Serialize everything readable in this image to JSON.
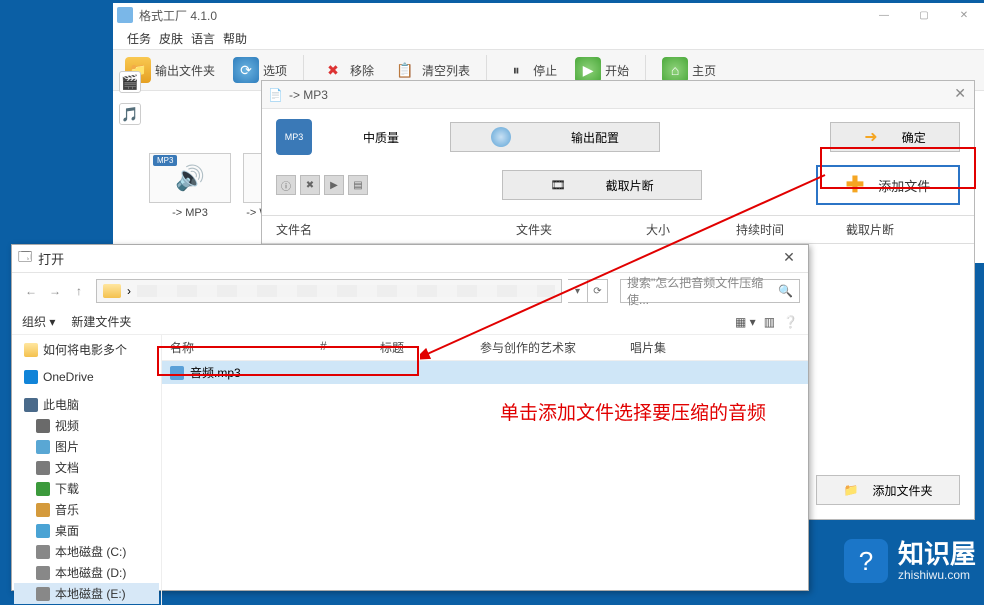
{
  "main": {
    "title": "格式工厂 4.1.0",
    "menu": [
      "任务",
      "皮肤",
      "语言",
      "帮助"
    ],
    "tools": {
      "outputFolder": "输出文件夹",
      "options": "选项",
      "remove": "移除",
      "clearList": "清空列表",
      "stop": "停止",
      "start": "开始",
      "home": "主页"
    },
    "thumb1": "-> MP3",
    "thumb1Badge": "MP3",
    "thumb2": "-> W"
  },
  "mp3win": {
    "title": "-> MP3",
    "iconLabel": "MP3",
    "quality": "中质量",
    "outputConfig": "输出配置",
    "ok": "确定",
    "clip": "截取片断",
    "addFile": "添加文件",
    "addFolder": "添加文件夹",
    "cols": [
      "文件名",
      "文件夹",
      "大小",
      "持续时间",
      "截取片断"
    ]
  },
  "open": {
    "title": "打开",
    "searchPlaceholder": "搜索\"怎么把音频文件压缩使...",
    "orgLabel": "组织",
    "newFolder": "新建文件夹",
    "tree": {
      "folder1": "如何将电影多个",
      "onedrive": "OneDrive",
      "pc": "此电脑",
      "video": "视频",
      "images": "图片",
      "docs": "文档",
      "downloads": "下载",
      "music": "音乐",
      "desktop": "桌面",
      "diskC": "本地磁盘 (C:)",
      "diskD": "本地磁盘 (D:)",
      "diskE": "本地磁盘 (E:)"
    },
    "fhead": [
      "名称",
      "#",
      "标题",
      "参与创作的艺术家",
      "唱片集"
    ],
    "file1": "音频.mp3"
  },
  "annot": "单击添加文件选择要压缩的音频",
  "brand": {
    "name": "知识屋",
    "url": "zhishiwu.com"
  }
}
